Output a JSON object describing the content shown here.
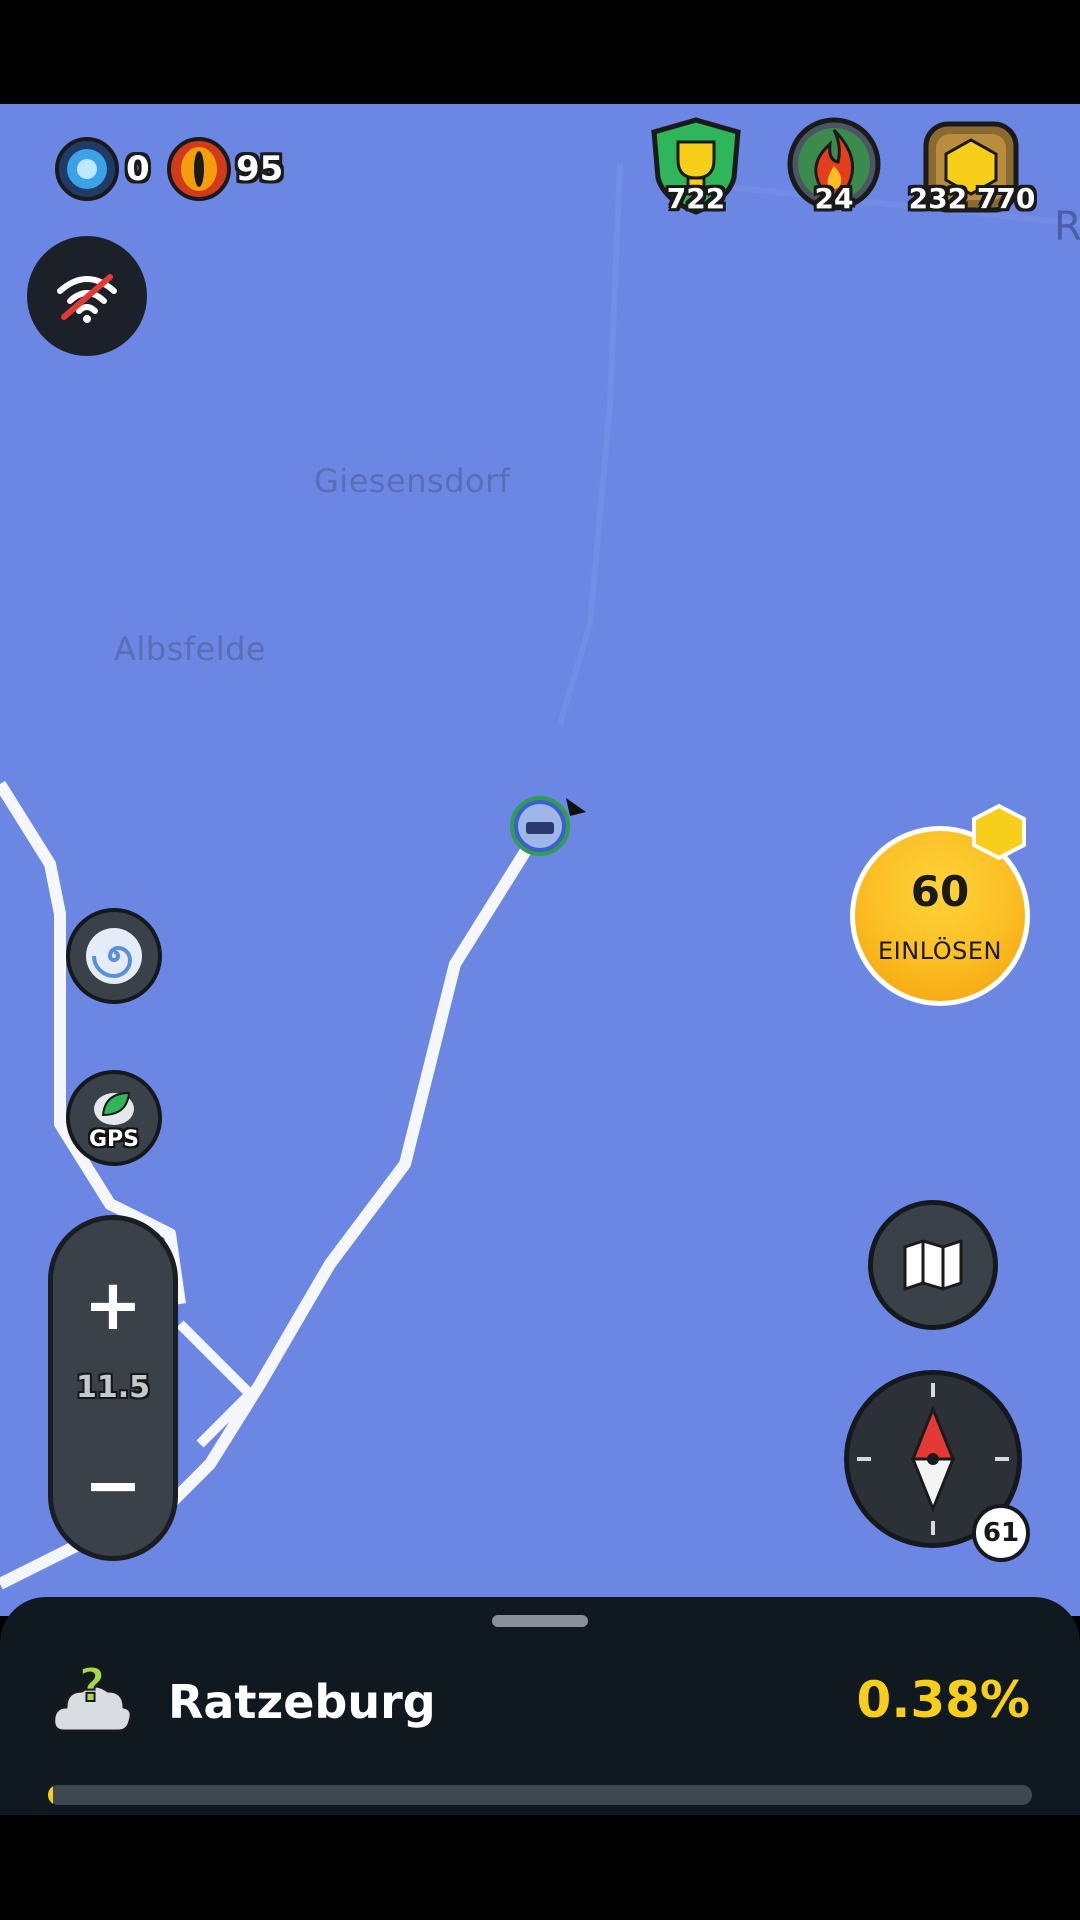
{
  "map": {
    "places": [
      "Giesensdorf",
      "Albsfelde"
    ],
    "edge_label": "R",
    "zoom_level": "11.5"
  },
  "counters": {
    "portals": "0",
    "eyes": "95",
    "trophies": "722",
    "streak": "24",
    "coins": "232 770"
  },
  "buttons": {
    "gps_label": "GPS",
    "zoom_in": "+",
    "zoom_out": "−",
    "redeem_amount": "60",
    "redeem_label": "EINLÖSEN",
    "compass_count": "61"
  },
  "icons": [
    "portal-icon",
    "eye-icon",
    "trophy-shield-icon",
    "fire-icon",
    "coin-chest-icon",
    "no-wifi-icon",
    "spiral-icon",
    "gps-leaf-icon",
    "map-icon",
    "compass-icon",
    "mystery-cloud-icon",
    "player-avatar-icon"
  ],
  "region": {
    "name": "Ratzeburg",
    "percent": "0.38%",
    "progress": 0.0038
  },
  "colors": {
    "map": "#6c86e4",
    "accent": "#f7cf1b",
    "panel": "#101820"
  }
}
